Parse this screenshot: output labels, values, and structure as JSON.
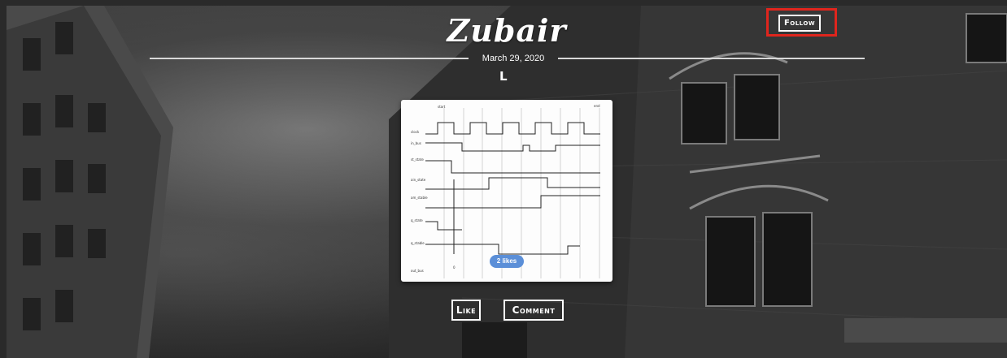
{
  "header": {
    "brand": "Zubair",
    "follow_label": "Follow"
  },
  "post": {
    "date": "March 29, 2020",
    "author_initial": "L",
    "likes": "2 likes",
    "image": {
      "labels": [
        "start",
        "end",
        "clock",
        "in_bus",
        "st_state",
        "ain_state",
        "am_stable",
        "q_state",
        "q_stable",
        "out_bus",
        "0"
      ]
    }
  },
  "actions": {
    "like_label": "Like",
    "comment_label": "Comment"
  }
}
